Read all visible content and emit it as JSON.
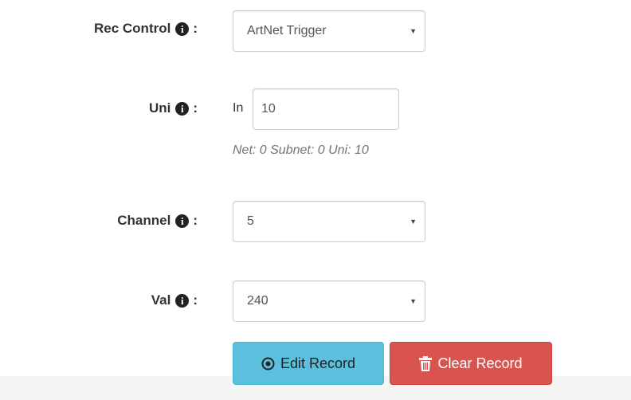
{
  "rec_control": {
    "label": "Rec Control",
    "colon": ":",
    "value": "ArtNet Trigger"
  },
  "uni": {
    "label": "Uni",
    "colon": ":",
    "prefix": "In",
    "value": "10",
    "help": "Net: 0 Subnet: 0 Uni: 10"
  },
  "channel": {
    "label": "Channel",
    "colon": ":",
    "value": "5"
  },
  "val": {
    "label": "Val",
    "colon": ":",
    "value": "240"
  },
  "buttons": {
    "edit_label": "Edit Record",
    "clear_label": "Clear Record"
  },
  "icons": {
    "info": "info-circle-icon",
    "caret": "caret-down-icon",
    "edit": "dot-circle-icon",
    "clear": "trash-icon"
  },
  "colors": {
    "edit_button": "#5bc0de",
    "clear_button": "#d9534f"
  }
}
